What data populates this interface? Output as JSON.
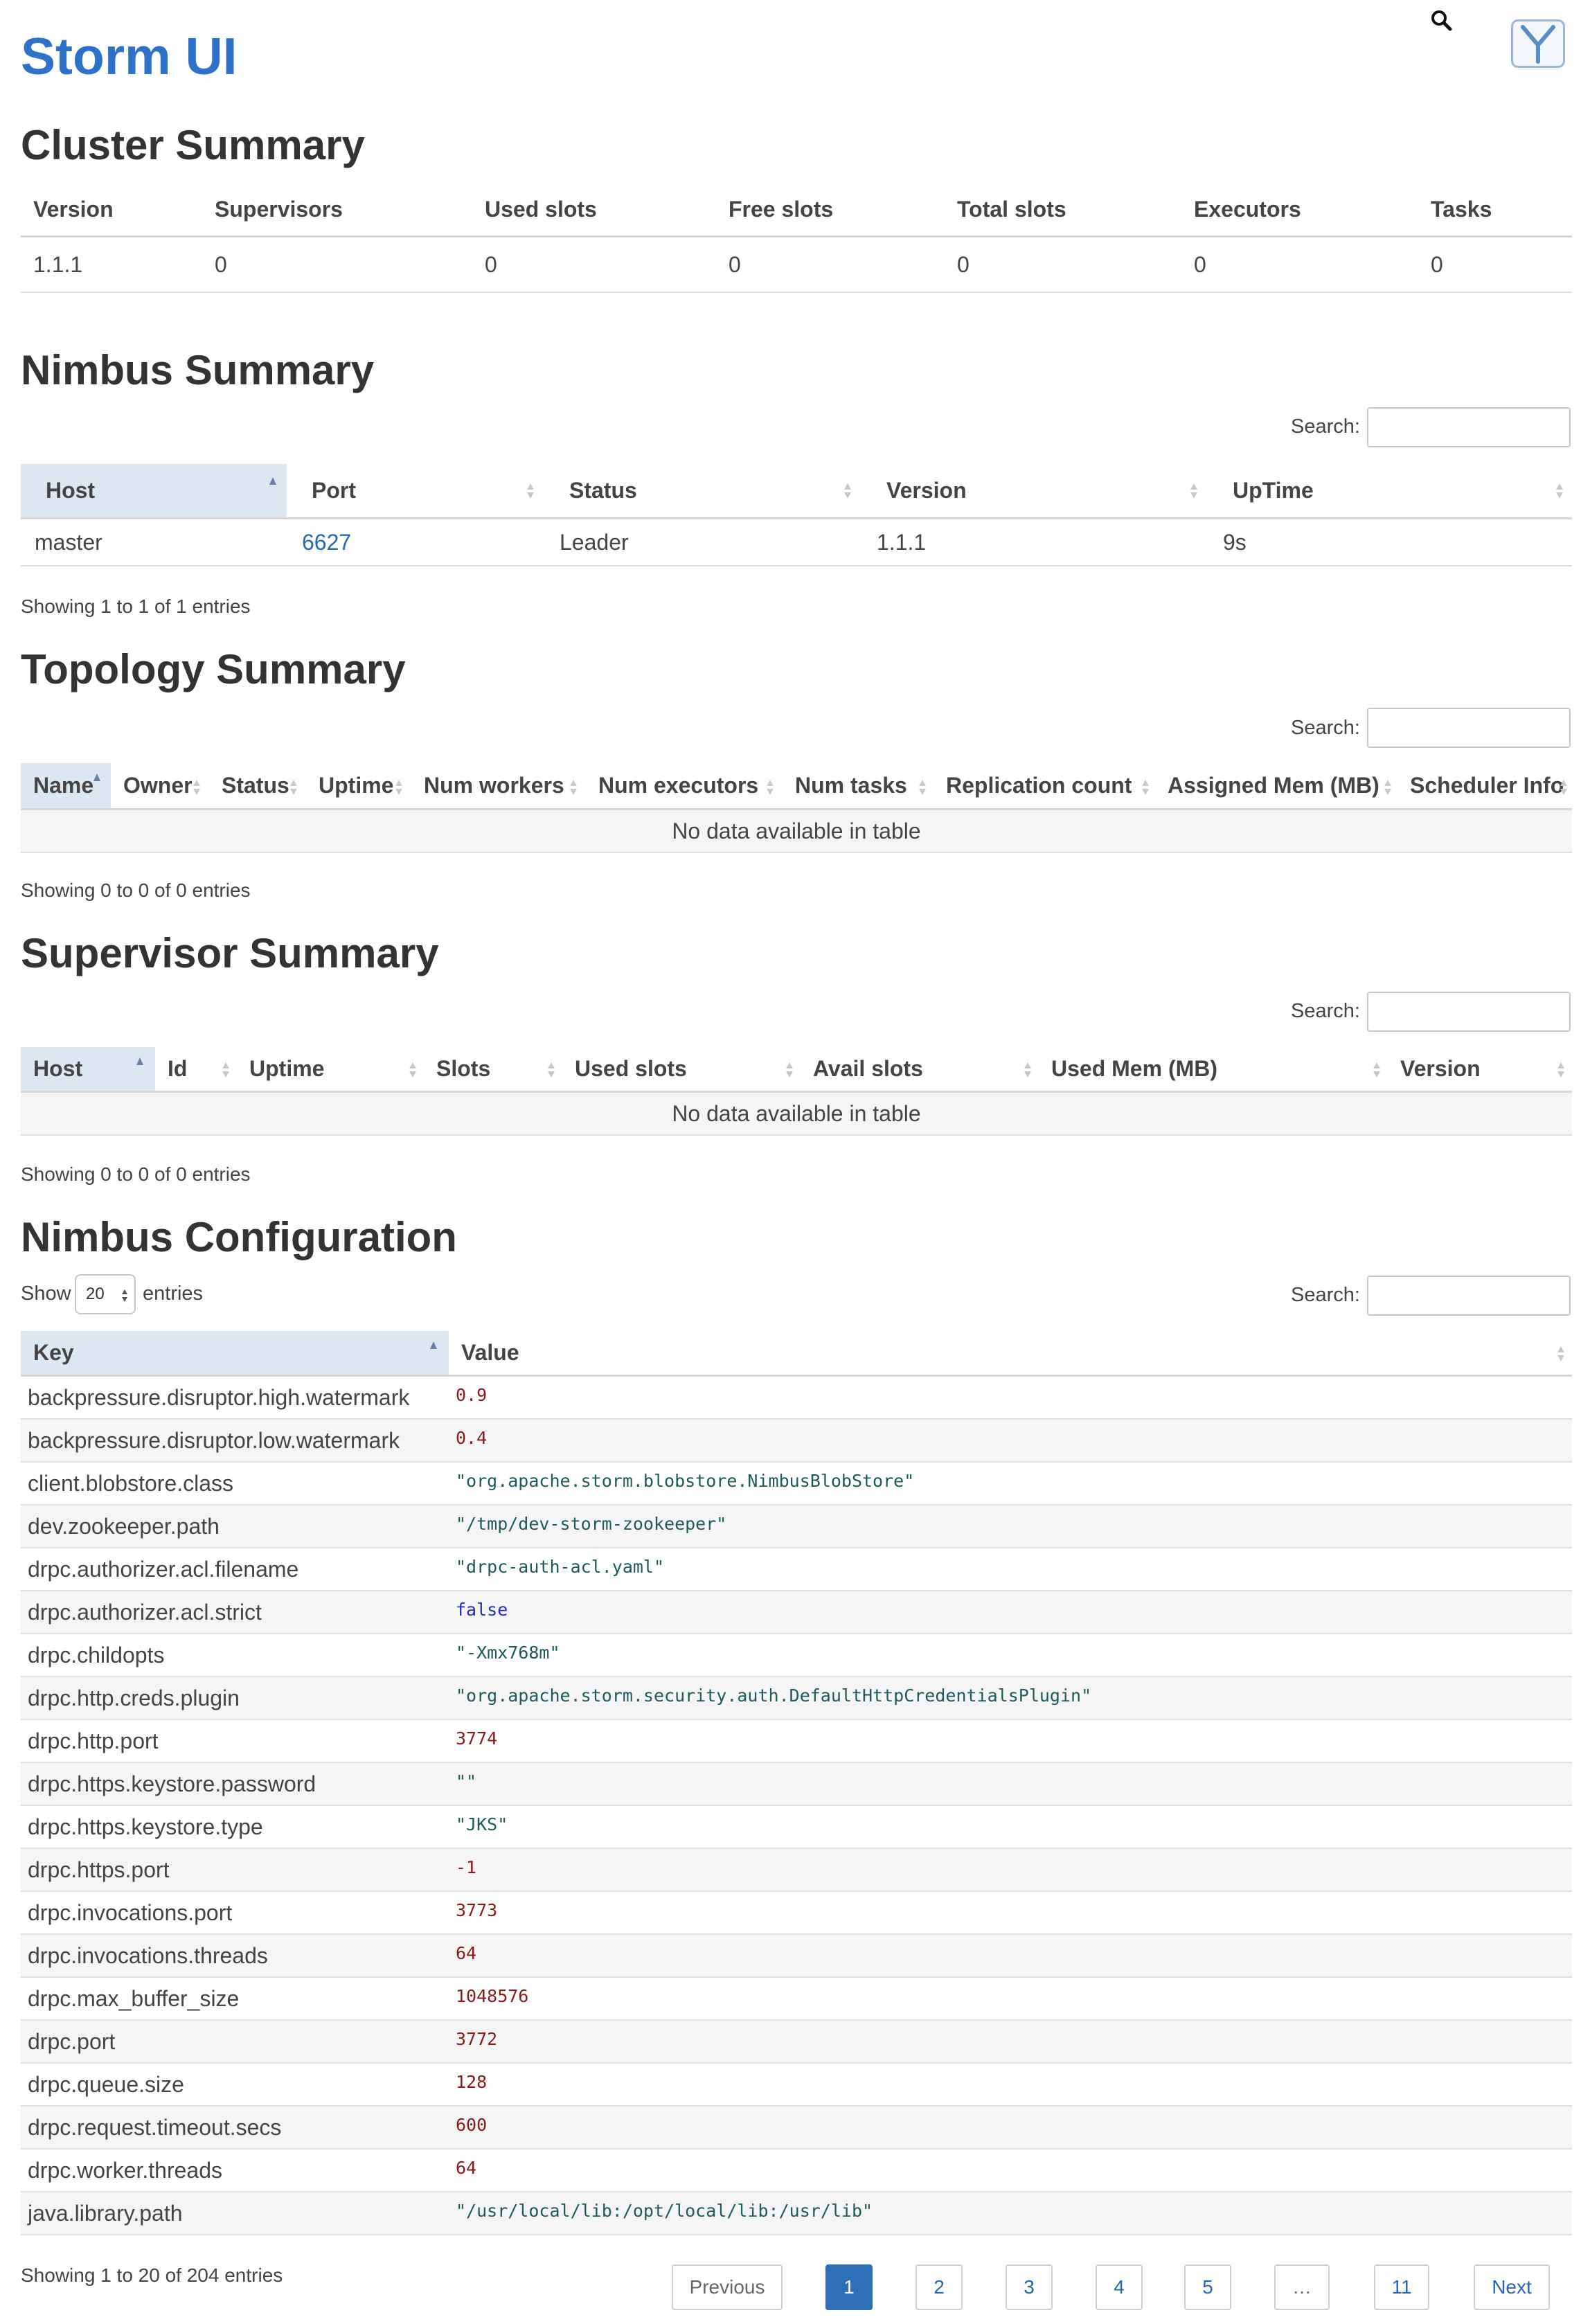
{
  "app": {
    "title": "Storm UI"
  },
  "icons": {
    "search": "search-icon",
    "logo": "yarn-logo-icon"
  },
  "colors": {
    "title_blue": "#2d71c8",
    "link_blue": "#2767b5",
    "number_red": "#8b1a1a",
    "string_teal": "#1e5a5a",
    "bool_blue": "#1e2fc8",
    "sorted_header": "#dde7f2"
  },
  "cluster": {
    "title": "Cluster Summary",
    "headers": [
      "Version",
      "Supervisors",
      "Used slots",
      "Free slots",
      "Total slots",
      "Executors",
      "Tasks"
    ],
    "rows": [
      [
        "1.1.1",
        "0",
        "0",
        "0",
        "0",
        "0",
        "0"
      ]
    ]
  },
  "nimbus": {
    "title": "Nimbus Summary",
    "search_label": "Search:",
    "headers": [
      "Host",
      "Port",
      "Status",
      "Version",
      "UpTime"
    ],
    "rows": [
      [
        "master",
        "6627",
        "Leader",
        "1.1.1",
        "9s"
      ]
    ],
    "info": "Showing 1 to 1 of 1 entries"
  },
  "topology": {
    "title": "Topology Summary",
    "search_label": "Search:",
    "headers": [
      "Name",
      "Owner",
      "Status",
      "Uptime",
      "Num workers",
      "Num executors",
      "Num tasks",
      "Replication count",
      "Assigned Mem (MB)",
      "Scheduler Info"
    ],
    "empty": "No data available in table",
    "info": "Showing 0 to 0 of 0 entries"
  },
  "supervisor": {
    "title": "Supervisor Summary",
    "search_label": "Search:",
    "headers": [
      "Host",
      "Id",
      "Uptime",
      "Slots",
      "Used slots",
      "Avail slots",
      "Used Mem (MB)",
      "Version"
    ],
    "empty": "No data available in table",
    "info": "Showing 0 to 0 of 0 entries"
  },
  "config": {
    "title": "Nimbus Configuration",
    "show_label": "Show",
    "entries_label": "entries",
    "page_size": "20",
    "search_label": "Search:",
    "headers": [
      "Key",
      "Value"
    ],
    "rows": [
      {
        "key": "backpressure.disruptor.high.watermark",
        "value": "0.9",
        "type": "num"
      },
      {
        "key": "backpressure.disruptor.low.watermark",
        "value": "0.4",
        "type": "num"
      },
      {
        "key": "client.blobstore.class",
        "value": "\"org.apache.storm.blobstore.NimbusBlobStore\"",
        "type": "str"
      },
      {
        "key": "dev.zookeeper.path",
        "value": "\"/tmp/dev-storm-zookeeper\"",
        "type": "str"
      },
      {
        "key": "drpc.authorizer.acl.filename",
        "value": "\"drpc-auth-acl.yaml\"",
        "type": "str"
      },
      {
        "key": "drpc.authorizer.acl.strict",
        "value": "false",
        "type": "bool"
      },
      {
        "key": "drpc.childopts",
        "value": "\"-Xmx768m\"",
        "type": "str"
      },
      {
        "key": "drpc.http.creds.plugin",
        "value": "\"org.apache.storm.security.auth.DefaultHttpCredentialsPlugin\"",
        "type": "str"
      },
      {
        "key": "drpc.http.port",
        "value": "3774",
        "type": "num"
      },
      {
        "key": "drpc.https.keystore.password",
        "value": "\"\"",
        "type": "str"
      },
      {
        "key": "drpc.https.keystore.type",
        "value": "\"JKS\"",
        "type": "str"
      },
      {
        "key": "drpc.https.port",
        "value": "-1",
        "type": "num"
      },
      {
        "key": "drpc.invocations.port",
        "value": "3773",
        "type": "num"
      },
      {
        "key": "drpc.invocations.threads",
        "value": "64",
        "type": "num"
      },
      {
        "key": "drpc.max_buffer_size",
        "value": "1048576",
        "type": "num"
      },
      {
        "key": "drpc.port",
        "value": "3772",
        "type": "num"
      },
      {
        "key": "drpc.queue.size",
        "value": "128",
        "type": "num"
      },
      {
        "key": "drpc.request.timeout.secs",
        "value": "600",
        "type": "num"
      },
      {
        "key": "drpc.worker.threads",
        "value": "64",
        "type": "num"
      },
      {
        "key": "java.library.path",
        "value": "\"/usr/local/lib:/opt/local/lib:/usr/lib\"",
        "type": "str"
      }
    ],
    "info": "Showing 1 to 20 of 204 entries"
  },
  "pagination": {
    "previous": "Previous",
    "next": "Next",
    "pages": [
      "1",
      "2",
      "3",
      "4",
      "5",
      "…",
      "11"
    ],
    "current": "1"
  }
}
